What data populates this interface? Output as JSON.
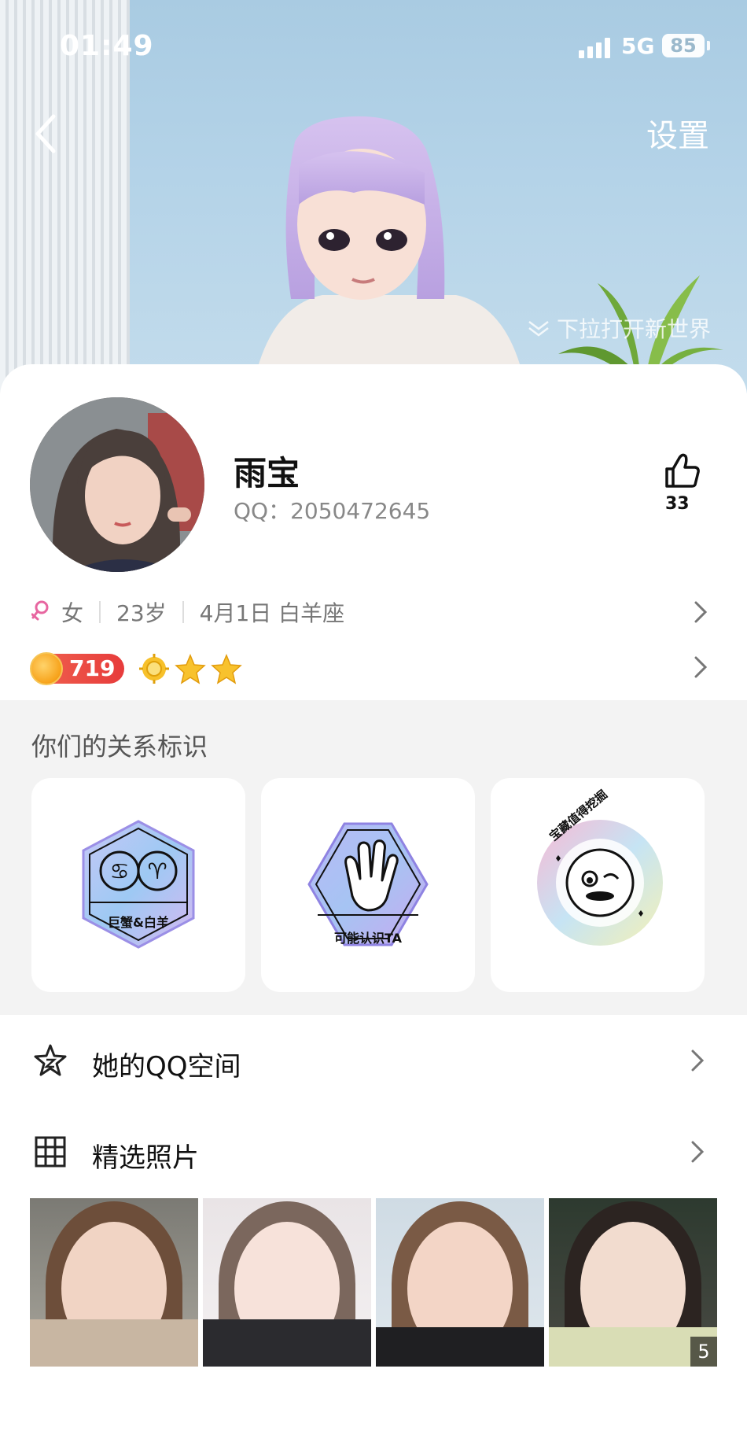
{
  "status_bar": {
    "time": "01:49",
    "network": "5G",
    "battery": "85"
  },
  "header": {
    "settings_label": "设置",
    "pull_hint": "下拉打开新世界"
  },
  "profile": {
    "nickname": "雨宝",
    "qq_label": "QQ：2050472645",
    "likes": "33",
    "gender": "女",
    "age": "23岁",
    "birthday": "4月1日 白羊座",
    "vip_level": "719"
  },
  "relation": {
    "title": "你们的关系标识",
    "badges": [
      {
        "label": "巨蟹&白羊",
        "icon": "zodiac-cancer-aries-icon"
      },
      {
        "label": "可能认识TA",
        "icon": "waving-hand-icon"
      },
      {
        "label": "宝藏值得挖掘",
        "icon": "treasure-face-icon"
      }
    ]
  },
  "menu": {
    "qzone_label": "她的QQ空间",
    "photos_label": "精选照片"
  },
  "photos": {
    "count": "5"
  },
  "colors": {
    "vip_red": "#e73b3b",
    "gold": "#f7a21a",
    "gender_pink": "#e766a0"
  }
}
